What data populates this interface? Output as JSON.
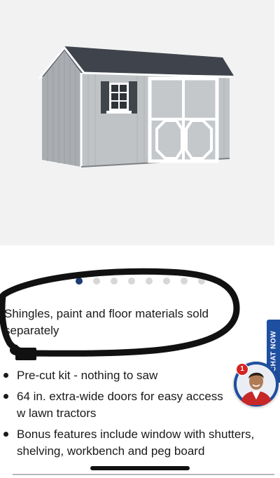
{
  "product": {
    "image_alt": "Storage shed",
    "carousel": {
      "total_slides": 9,
      "active_slide": 1
    }
  },
  "note": {
    "text": "Shingles, paint and floor materials sold separately"
  },
  "features": [
    {
      "text": "Pre-cut kit - nothing to saw"
    },
    {
      "text": "64 in. extra-wide doors for easy access w lawn tractors"
    },
    {
      "text": "Bonus features include window with shutters, shelving, workbench and peg board"
    }
  ],
  "chat": {
    "tab_label": "CHAT NOW",
    "badge_count": "1"
  },
  "colors": {
    "chat_blue": "#1f4fa0",
    "dot_active": "#1f3b73",
    "badge_red": "#d42424"
  }
}
